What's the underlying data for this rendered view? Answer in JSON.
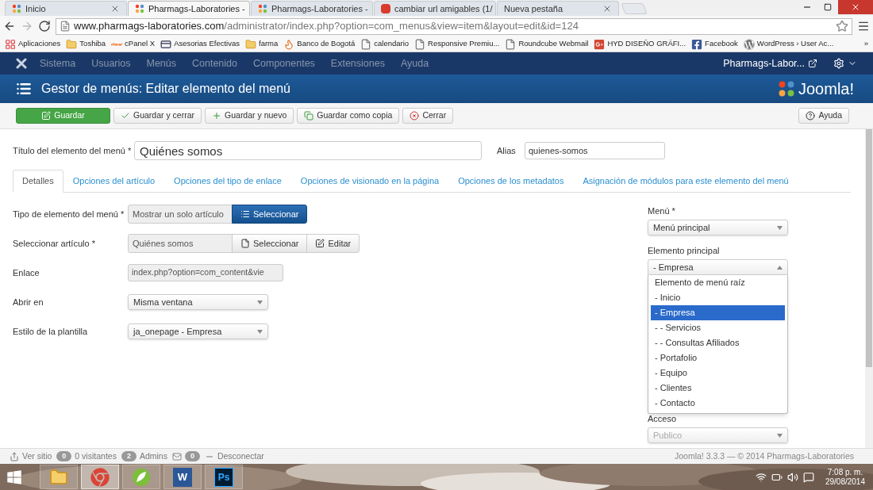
{
  "browser": {
    "tabs": [
      {
        "title": "Inicio",
        "kind": "joomla",
        "selected": false
      },
      {
        "title": "Pharmags-Laboratories -",
        "kind": "joomla",
        "selected": true
      },
      {
        "title": "Pharmags-Laboratories -",
        "kind": "joomla",
        "selected": false
      },
      {
        "title": "cambiar url amigables (1/",
        "kind": "red",
        "selected": false
      },
      {
        "title": "Nueva pestaña",
        "kind": "blank",
        "selected": false
      }
    ],
    "url": {
      "host": "www.pharmags-laboratories.com",
      "path": "/administrator/index.php?option=com_menus&view=item&layout=edit&id=124"
    },
    "bookmarks": [
      {
        "label": "Aplicaciones",
        "kind": "apps"
      },
      {
        "label": "Toshiba",
        "kind": "folder"
      },
      {
        "label": "cPanel X",
        "kind": "cpanel"
      },
      {
        "label": "Asesorias Efectivas",
        "kind": "card"
      },
      {
        "label": "farma",
        "kind": "folder"
      },
      {
        "label": "Banco de Bogotá",
        "kind": "flame"
      },
      {
        "label": "calendario",
        "kind": "page"
      },
      {
        "label": "Responsive Premiu...",
        "kind": "page"
      },
      {
        "label": "Roundcube Webmail",
        "kind": "page"
      },
      {
        "label": "HYD DISEÑO GRÁFI...",
        "kind": "gplus"
      },
      {
        "label": "Facebook",
        "kind": "facebook"
      },
      {
        "label": "WordPress › User Ac...",
        "kind": "wordpress"
      }
    ],
    "more": "»"
  },
  "admin": {
    "nav": [
      "Sistema",
      "Usuarios",
      "Menús",
      "Contenido",
      "Componentes",
      "Extensiones",
      "Ayuda"
    ],
    "site_link": "Pharmags-Labor...",
    "page_title": "Gestor de menús: Editar elemento del menú",
    "logo_text": "Joomla!",
    "toolbar": [
      {
        "label": "Guardar",
        "kind": "primary"
      },
      {
        "label": "Guardar y cerrar",
        "kind": "default"
      },
      {
        "label": "Guardar y nuevo",
        "kind": "default"
      },
      {
        "label": "Guardar como copia",
        "kind": "default"
      },
      {
        "label": "Cerrar",
        "kind": "default"
      }
    ],
    "help_button": "Ayuda"
  },
  "form": {
    "title_field": {
      "label": "Título del elemento del menú *",
      "value": "Quiénes somos"
    },
    "alias_field": {
      "label": "Alias",
      "value": "quienes-somos"
    },
    "tabs": [
      {
        "label": "Detalles",
        "selected": true
      },
      {
        "label": "Opciones del artículo",
        "selected": false
      },
      {
        "label": "Opciones del tipo de enlace",
        "selected": false
      },
      {
        "label": "Opciones de visionado en la página",
        "selected": false
      },
      {
        "label": "Opciones de los metadatos",
        "selected": false
      },
      {
        "label": "Asignación de módulos para este elemento del menú",
        "selected": false
      }
    ],
    "left_fields": [
      {
        "kind": "chooser",
        "label": "Tipo de elemento del menú *",
        "value": "Mostrar un solo artículo",
        "buttons": [
          {
            "label": "Seleccionar",
            "primary": true
          }
        ]
      },
      {
        "kind": "chooser",
        "label": "Seleccionar artículo *",
        "value": "Quiénes somos",
        "buttons": [
          {
            "label": "Seleccionar",
            "primary": false
          },
          {
            "label": "Editar",
            "primary": false
          }
        ]
      },
      {
        "kind": "readonly",
        "label": "Enlace",
        "value": "index.php?option=com_content&vie"
      },
      {
        "kind": "select",
        "label": "Abrir en",
        "value": "Misma ventana"
      },
      {
        "kind": "select",
        "label": "Estilo de la plantilla",
        "value": "ja_onepage - Empresa"
      }
    ],
    "right_fields": [
      {
        "label": "Menú *",
        "value": "Menú principal",
        "expanded": false,
        "disabled": false
      },
      {
        "label": "Elemento principal",
        "value": "- Empresa",
        "expanded": true,
        "disabled": false,
        "options": [
          {
            "label": "Elemento de menú raíz",
            "selected": false
          },
          {
            "label": "- Inicio",
            "selected": false
          },
          {
            "label": "- Empresa",
            "selected": true
          },
          {
            "label": "- - Servicios",
            "selected": false
          },
          {
            "label": "- - Consultas Afiliados",
            "selected": false
          },
          {
            "label": "- Portafolio",
            "selected": false
          },
          {
            "label": "- Equipo",
            "selected": false
          },
          {
            "label": "- Clientes",
            "selected": false
          },
          {
            "label": "- Contacto",
            "selected": false
          }
        ]
      },
      {
        "label": "Acceso",
        "value": "Publico",
        "expanded": false,
        "disabled": true
      }
    ]
  },
  "status_bar": {
    "items": [
      {
        "kind": "view-site",
        "label": "Ver sitio"
      },
      {
        "kind": "badge",
        "count": "0",
        "label": "0 visitantes"
      },
      {
        "kind": "badge",
        "count": "2",
        "label": "Admins"
      },
      {
        "kind": "mail",
        "count": "0"
      },
      {
        "kind": "logout",
        "label": "Desconectar"
      }
    ],
    "right": "Joomla! 3.3.3 — © 2014 Pharmags-Laboratories"
  },
  "taskbar": {
    "apps": [
      {
        "kind": "folder",
        "active": false
      },
      {
        "kind": "chrome",
        "active": true
      },
      {
        "kind": "leaf",
        "active": false
      },
      {
        "kind": "word",
        "label": "W",
        "active": false
      },
      {
        "kind": "photoshop",
        "label": "Ps",
        "active": false
      }
    ],
    "time": "7:08 p. m.",
    "date": "29/08/2014"
  }
}
